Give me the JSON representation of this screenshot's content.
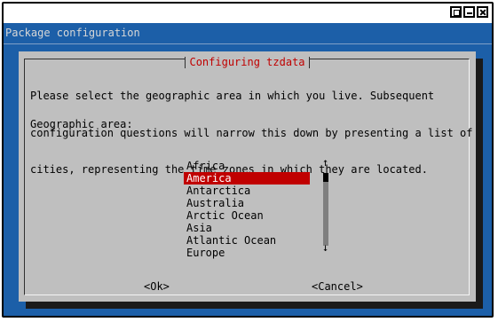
{
  "backtitle": "Package configuration",
  "dialog": {
    "title": "Configuring tzdata",
    "prompt_lines": [
      "Please select the geographic area in which you live. Subsequent",
      "configuration questions will narrow this down by presenting a list of",
      "cities, representing the time zones in which they are located."
    ],
    "area_label": "Geographic area:",
    "areas": [
      "Africa",
      "America",
      "Antarctica",
      "Australia",
      "Arctic Ocean",
      "Asia",
      "Atlantic Ocean",
      "Europe"
    ],
    "selected_area": "America",
    "ok_button": "<Ok>",
    "cancel_button": "<Cancel>",
    "scroll_up_glyph": "↑",
    "scroll_down_glyph": "↓"
  },
  "colors": {
    "background": "#1c5fa8",
    "dialog": "#bfbfbf",
    "title_text": "#c00000",
    "selection": "#c00000"
  }
}
